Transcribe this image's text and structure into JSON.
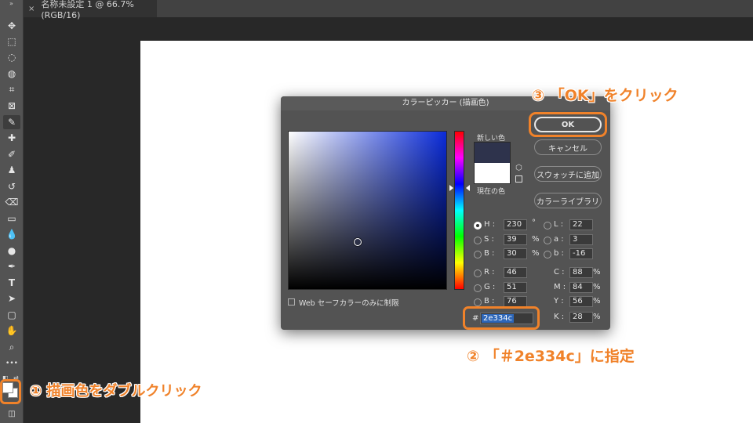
{
  "tab": {
    "title": "名称未設定 1 @ 66.7% (RGB/16)",
    "close": "×"
  },
  "toolbar": {
    "collapse": "»",
    "tools": [
      {
        "name": "move-tool-icon",
        "glyph": "✥"
      },
      {
        "name": "marquee-tool-icon",
        "glyph": "⬚"
      },
      {
        "name": "lasso-tool-icon",
        "glyph": "◌"
      },
      {
        "name": "quick-select-tool-icon",
        "glyph": "◍"
      },
      {
        "name": "crop-tool-icon",
        "glyph": "⌗"
      },
      {
        "name": "frame-tool-icon",
        "glyph": "⊠"
      },
      {
        "name": "eyedropper-tool-icon",
        "glyph": "✎"
      },
      {
        "name": "healing-brush-tool-icon",
        "glyph": "✚"
      },
      {
        "name": "brush-tool-icon",
        "glyph": "✐"
      },
      {
        "name": "stamp-tool-icon",
        "glyph": "♟"
      },
      {
        "name": "history-brush-tool-icon",
        "glyph": "↺"
      },
      {
        "name": "eraser-tool-icon",
        "glyph": "⌫"
      },
      {
        "name": "gradient-tool-icon",
        "glyph": "▭"
      },
      {
        "name": "blur-tool-icon",
        "glyph": "💧"
      },
      {
        "name": "dodge-tool-icon",
        "glyph": "●"
      },
      {
        "name": "pen-tool-icon",
        "glyph": "✒"
      },
      {
        "name": "type-tool-icon",
        "glyph": "T"
      },
      {
        "name": "path-select-tool-icon",
        "glyph": "➤"
      },
      {
        "name": "shape-tool-icon",
        "glyph": "▢"
      },
      {
        "name": "hand-tool-icon",
        "glyph": "✋"
      },
      {
        "name": "zoom-tool-icon",
        "glyph": "⌕"
      },
      {
        "name": "more-tools-icon",
        "glyph": "•••"
      }
    ]
  },
  "dialog": {
    "title": "カラーピッカー (描画色)",
    "new_label": "新しい色",
    "current_label": "現在の色",
    "new_color": "#2e334c",
    "current_color": "#ffffff",
    "buttons": {
      "ok": "OK",
      "cancel": "キャンセル",
      "add_swatch": "スウォッチに追加",
      "color_library": "カラーライブラリ"
    },
    "hsb": [
      {
        "label": "H :",
        "value": "230",
        "unit": "°",
        "selected": true
      },
      {
        "label": "S :",
        "value": "39",
        "unit": "%",
        "selected": false
      },
      {
        "label": "B :",
        "value": "30",
        "unit": "%",
        "selected": false
      }
    ],
    "rgb": [
      {
        "label": "R :",
        "value": "46"
      },
      {
        "label": "G :",
        "value": "51"
      },
      {
        "label": "B :",
        "value": "76"
      }
    ],
    "lab": [
      {
        "label": "L :",
        "value": "22"
      },
      {
        "label": "a :",
        "value": "3"
      },
      {
        "label": "b :",
        "value": "-16"
      }
    ],
    "cmyk": [
      {
        "label": "C :",
        "value": "88",
        "unit": "%"
      },
      {
        "label": "M :",
        "value": "84",
        "unit": "%"
      },
      {
        "label": "Y :",
        "value": "56",
        "unit": "%"
      },
      {
        "label": "K :",
        "value": "28",
        "unit": "%"
      }
    ],
    "hex_prefix": "#",
    "hex_value": "2e334c",
    "websafe_label": "Web セーフカラーのみに制限"
  },
  "annotations": {
    "step1": "① 描画色をダブルクリック",
    "step2": "② 「＃2e334c」に指定",
    "step3": "③ 「OK」をクリック",
    "accent_color": "#f0822a"
  }
}
